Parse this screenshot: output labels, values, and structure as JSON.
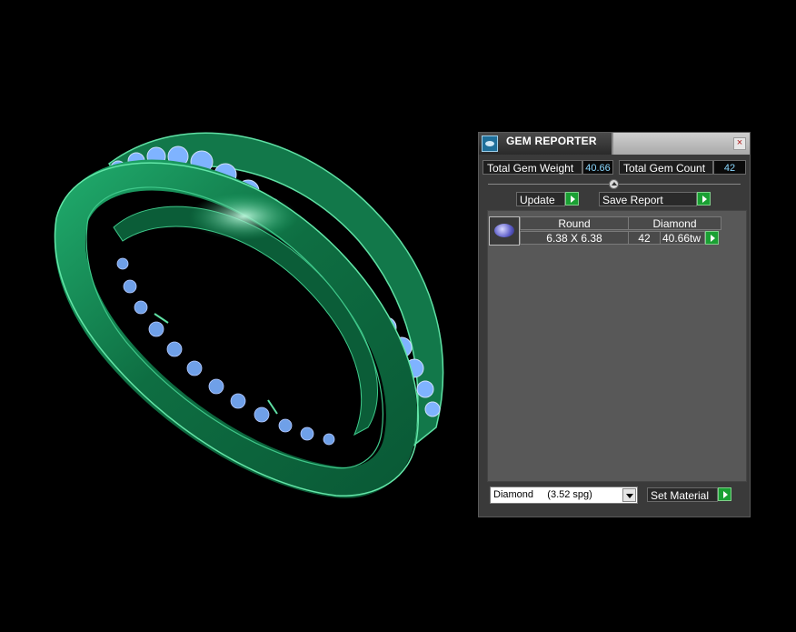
{
  "window": {
    "title": "GEM REPORTER",
    "app_icon": "gem-reporter-icon",
    "close_icon": "close-icon",
    "close_symbol": "×"
  },
  "stats": {
    "weight_label": "Total Gem Weight",
    "weight_value": "40.66",
    "count_label": "Total Gem Count",
    "count_value": "42"
  },
  "actions": {
    "update_label": "Update",
    "save_report_label": "Save Report"
  },
  "gems": [
    {
      "thumbnail_icon": "round-gem-icon",
      "cut": "Round",
      "material": "Diamond",
      "size": "6.38 X 6.38",
      "count": "42",
      "weight": "40.66tw"
    }
  ],
  "material": {
    "selected": "Diamond     (3.52 spg)",
    "set_label": "Set Material"
  },
  "colors": {
    "ring": "#1a9a5c",
    "ring_highlight": "#74e0ad",
    "gems": "#7fb3ff",
    "value_text": "#8ad8ff",
    "action_button": "#1aa033"
  }
}
